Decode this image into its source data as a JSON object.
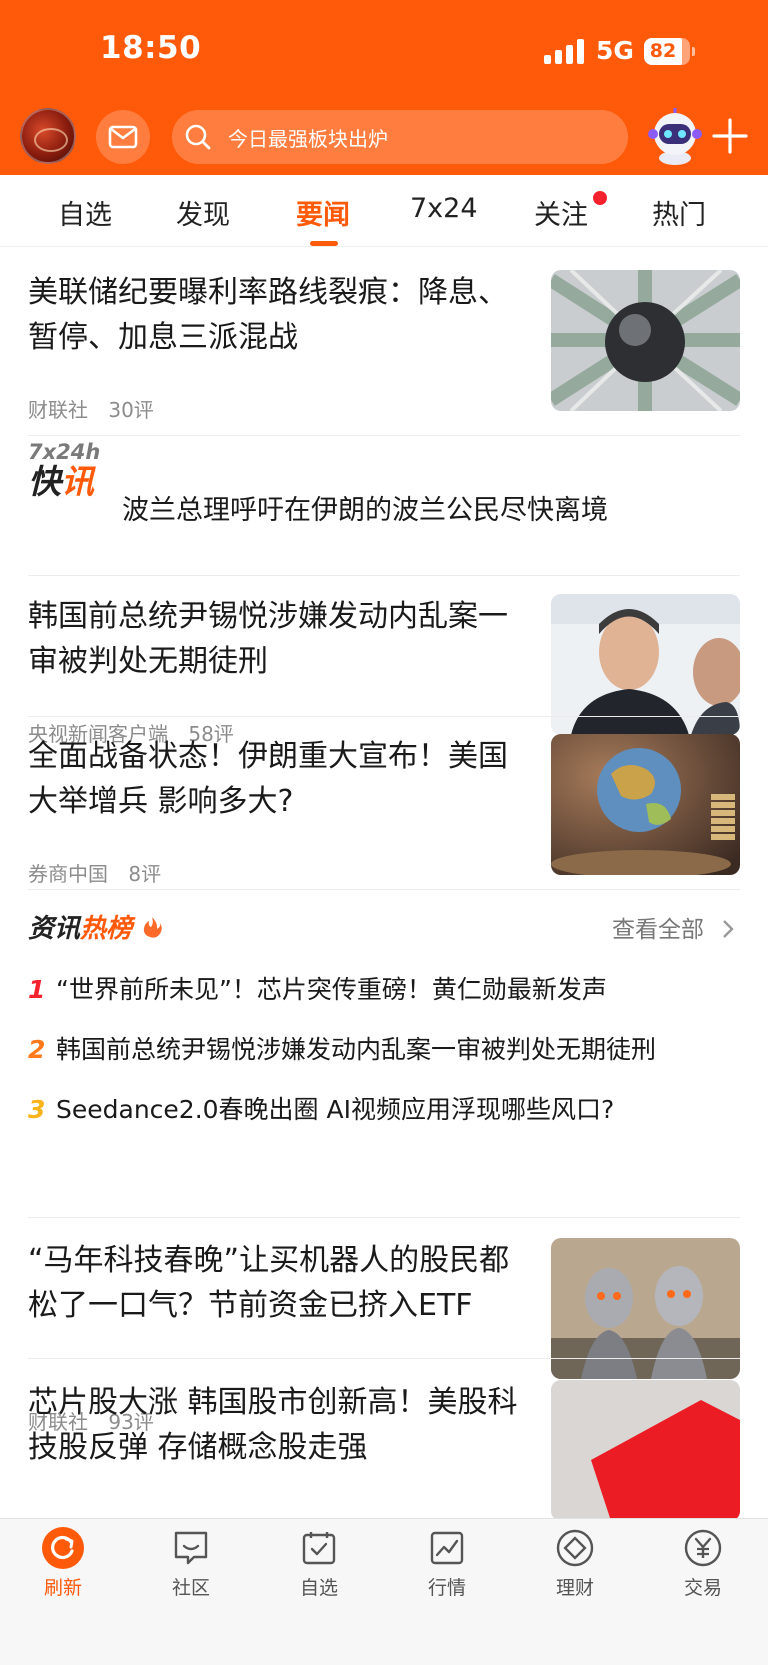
{
  "status_bar": {
    "time": "18:50",
    "network": "5G",
    "battery": "82"
  },
  "header": {
    "search_placeholder": "今日最强板块出炉"
  },
  "tabs": [
    {
      "label": "自选"
    },
    {
      "label": "发现"
    },
    {
      "label": "要闻",
      "active": true
    },
    {
      "label": "7x24"
    },
    {
      "label": "关注",
      "badge": true
    },
    {
      "label": "热门"
    }
  ],
  "articles": [
    {
      "title": "美联储纪要曝利率路线裂痕：降息、暂停、加息三派混战",
      "source": "财联社",
      "comments": "30评",
      "thumb": "globe-dollars"
    },
    {
      "title": "韩国前总统尹锡悦涉嫌发动内乱案一审被判处无期徒刑",
      "source": "央视新闻客户端",
      "comments": "58评",
      "thumb": "portrait"
    },
    {
      "title": "全面战备状态！伊朗重大宣布！美国大举增兵 影响多大?",
      "source": "券商中国",
      "comments": "8评",
      "thumb": "globe-coins"
    },
    {
      "title": "“马年科技春晚”让买机器人的股民都松了一口气？节前资金已挤入ETF",
      "source": "财联社",
      "comments": "93评",
      "thumb": "robots"
    },
    {
      "title": "芯片股大涨 韩国股市创新高！美股科技股反弹 存储概念股走强",
      "source": "",
      "comments": "",
      "thumb": "red"
    }
  ],
  "flash": {
    "logo_top": "7x24h",
    "logo_bottom_a": "快",
    "logo_bottom_b": "讯",
    "text": "波兰总理呼吁在伊朗的波兰公民尽快离境"
  },
  "hot_list": {
    "title_a": "资讯",
    "title_b": "热榜",
    "see_all": "查看全部",
    "items": [
      {
        "rank": "1",
        "text": "“世界前所未见”！芯片突传重磅！黄仁勋最新发声",
        "color": "#f5222d"
      },
      {
        "rank": "2",
        "text": "韩国前总统尹锡悦涉嫌发动内乱案一审被判处无期徒刑",
        "color": "#ff7a1a"
      },
      {
        "rank": "3",
        "text": "Seedance2.0春晚出圈 AI视频应用浮现哪些风口?",
        "color": "#fbb41a"
      }
    ]
  },
  "bottom_nav": [
    {
      "label": "刷新",
      "icon": "refresh-icon",
      "active": true
    },
    {
      "label": "社区",
      "icon": "chat-icon"
    },
    {
      "label": "自选",
      "icon": "check-icon"
    },
    {
      "label": "行情",
      "icon": "chart-icon"
    },
    {
      "label": "理财",
      "icon": "diamond-icon"
    },
    {
      "label": "交易",
      "icon": "yuan-icon"
    }
  ],
  "colors": {
    "brand": "#ff5a0a",
    "badge": "#f5222d"
  }
}
